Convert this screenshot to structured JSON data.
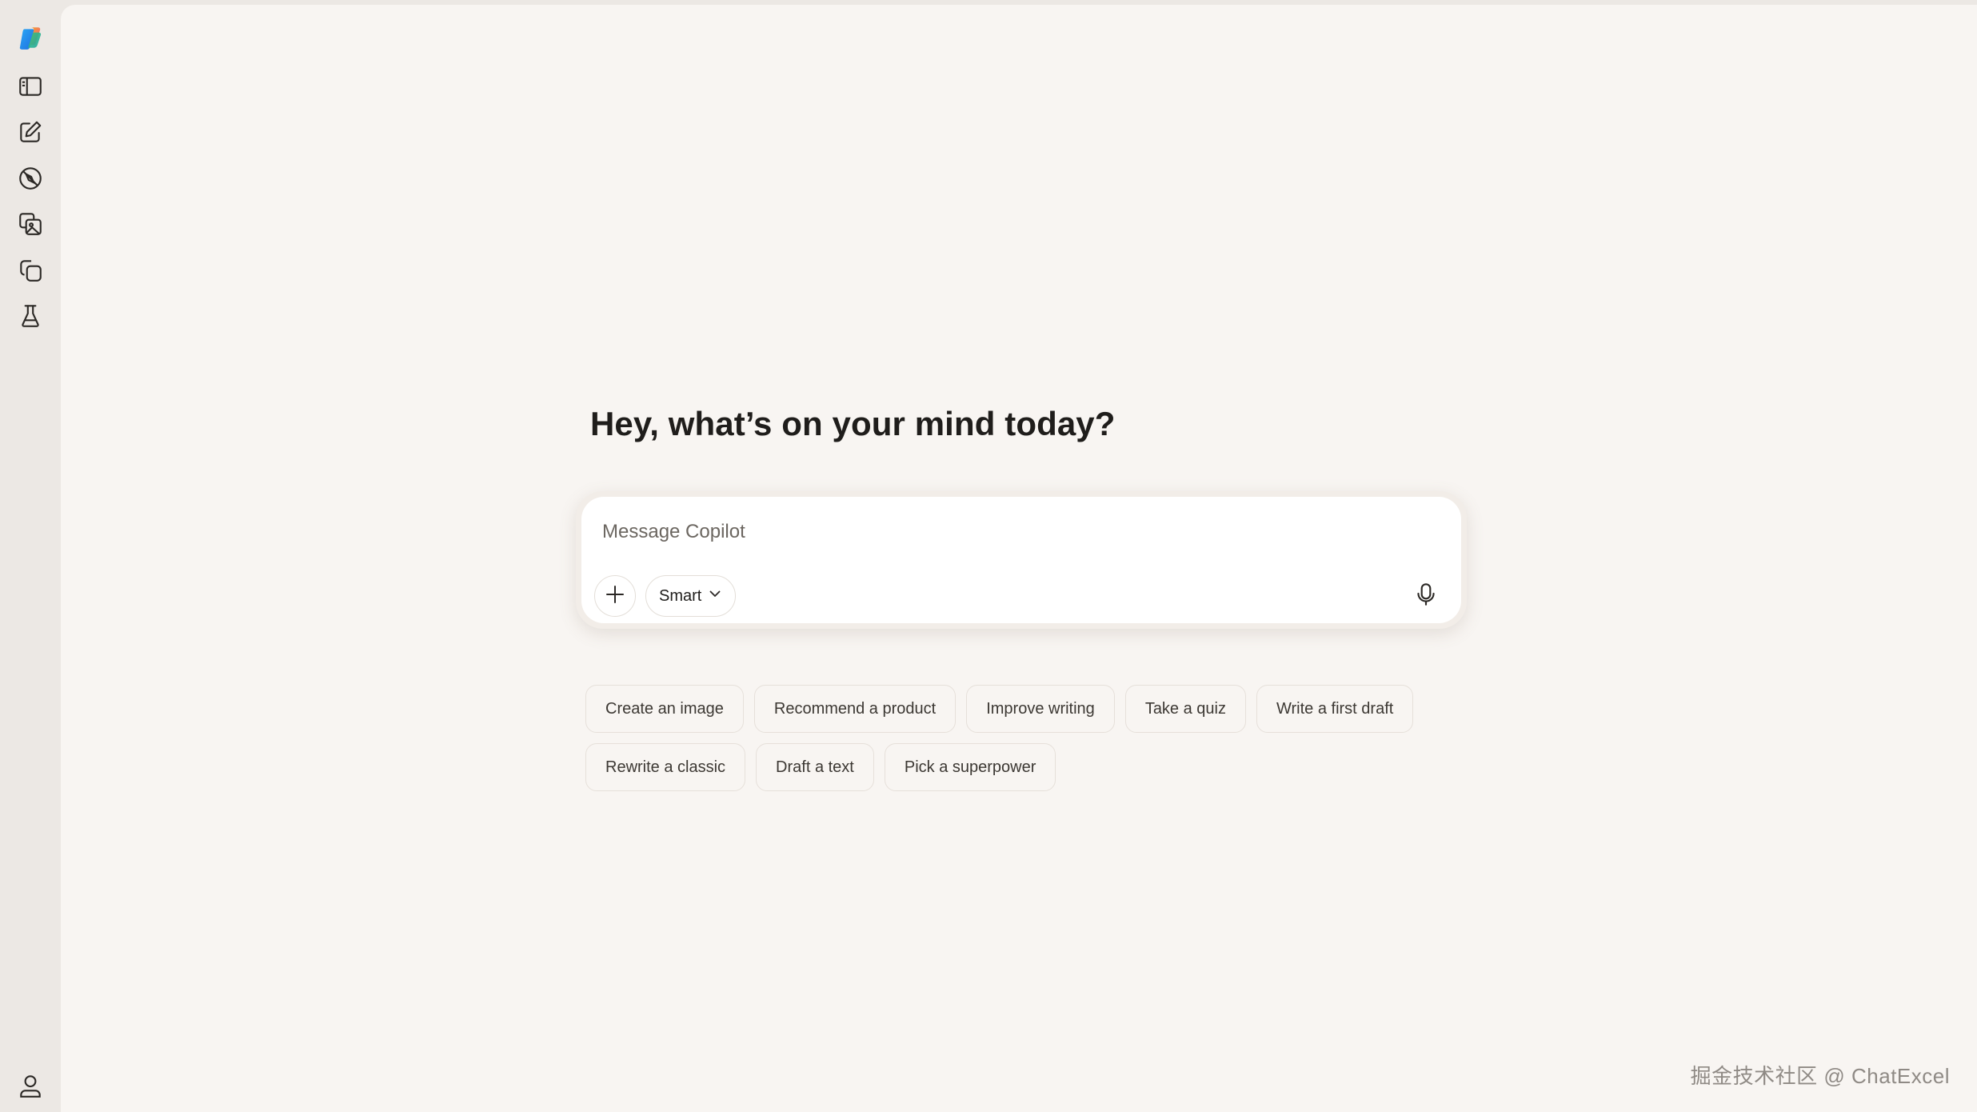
{
  "sidebar": {
    "items": [
      {
        "icon": "copilot-logo-icon",
        "label": "Copilot"
      },
      {
        "icon": "sidebar-toggle-icon",
        "label": "Toggle sidebar"
      },
      {
        "icon": "new-chat-icon",
        "label": "New chat"
      },
      {
        "icon": "discover-icon",
        "label": "Discover"
      },
      {
        "icon": "image-gallery-icon",
        "label": "Images"
      },
      {
        "icon": "pages-icon",
        "label": "Pages"
      },
      {
        "icon": "labs-flask-icon",
        "label": "Labs"
      }
    ],
    "profile_icon": "profile-icon"
  },
  "main": {
    "greeting": "Hey, what’s on your mind today?",
    "composer": {
      "placeholder": "Message Copilot",
      "value": "",
      "mode_label": "Smart",
      "mode_icon": "chevron-down-icon",
      "add_icon": "plus-icon",
      "mic_icon": "microphone-icon"
    },
    "suggestions": {
      "row1": [
        "Create an image",
        "Recommend a product",
        "Improve writing",
        "Take a quiz",
        "Write a first draft"
      ],
      "row2": [
        "Rewrite a classic",
        "Draft a text",
        "Pick a superpower"
      ]
    }
  },
  "watermark": "掘金技术社区 @ ChatExcel",
  "colors": {
    "rail_bg": "#ece8e4",
    "main_bg": "#f8f5f2",
    "composer_bg": "#ffffff",
    "text": "#1f1d1b",
    "muted_text": "#6b6660"
  }
}
